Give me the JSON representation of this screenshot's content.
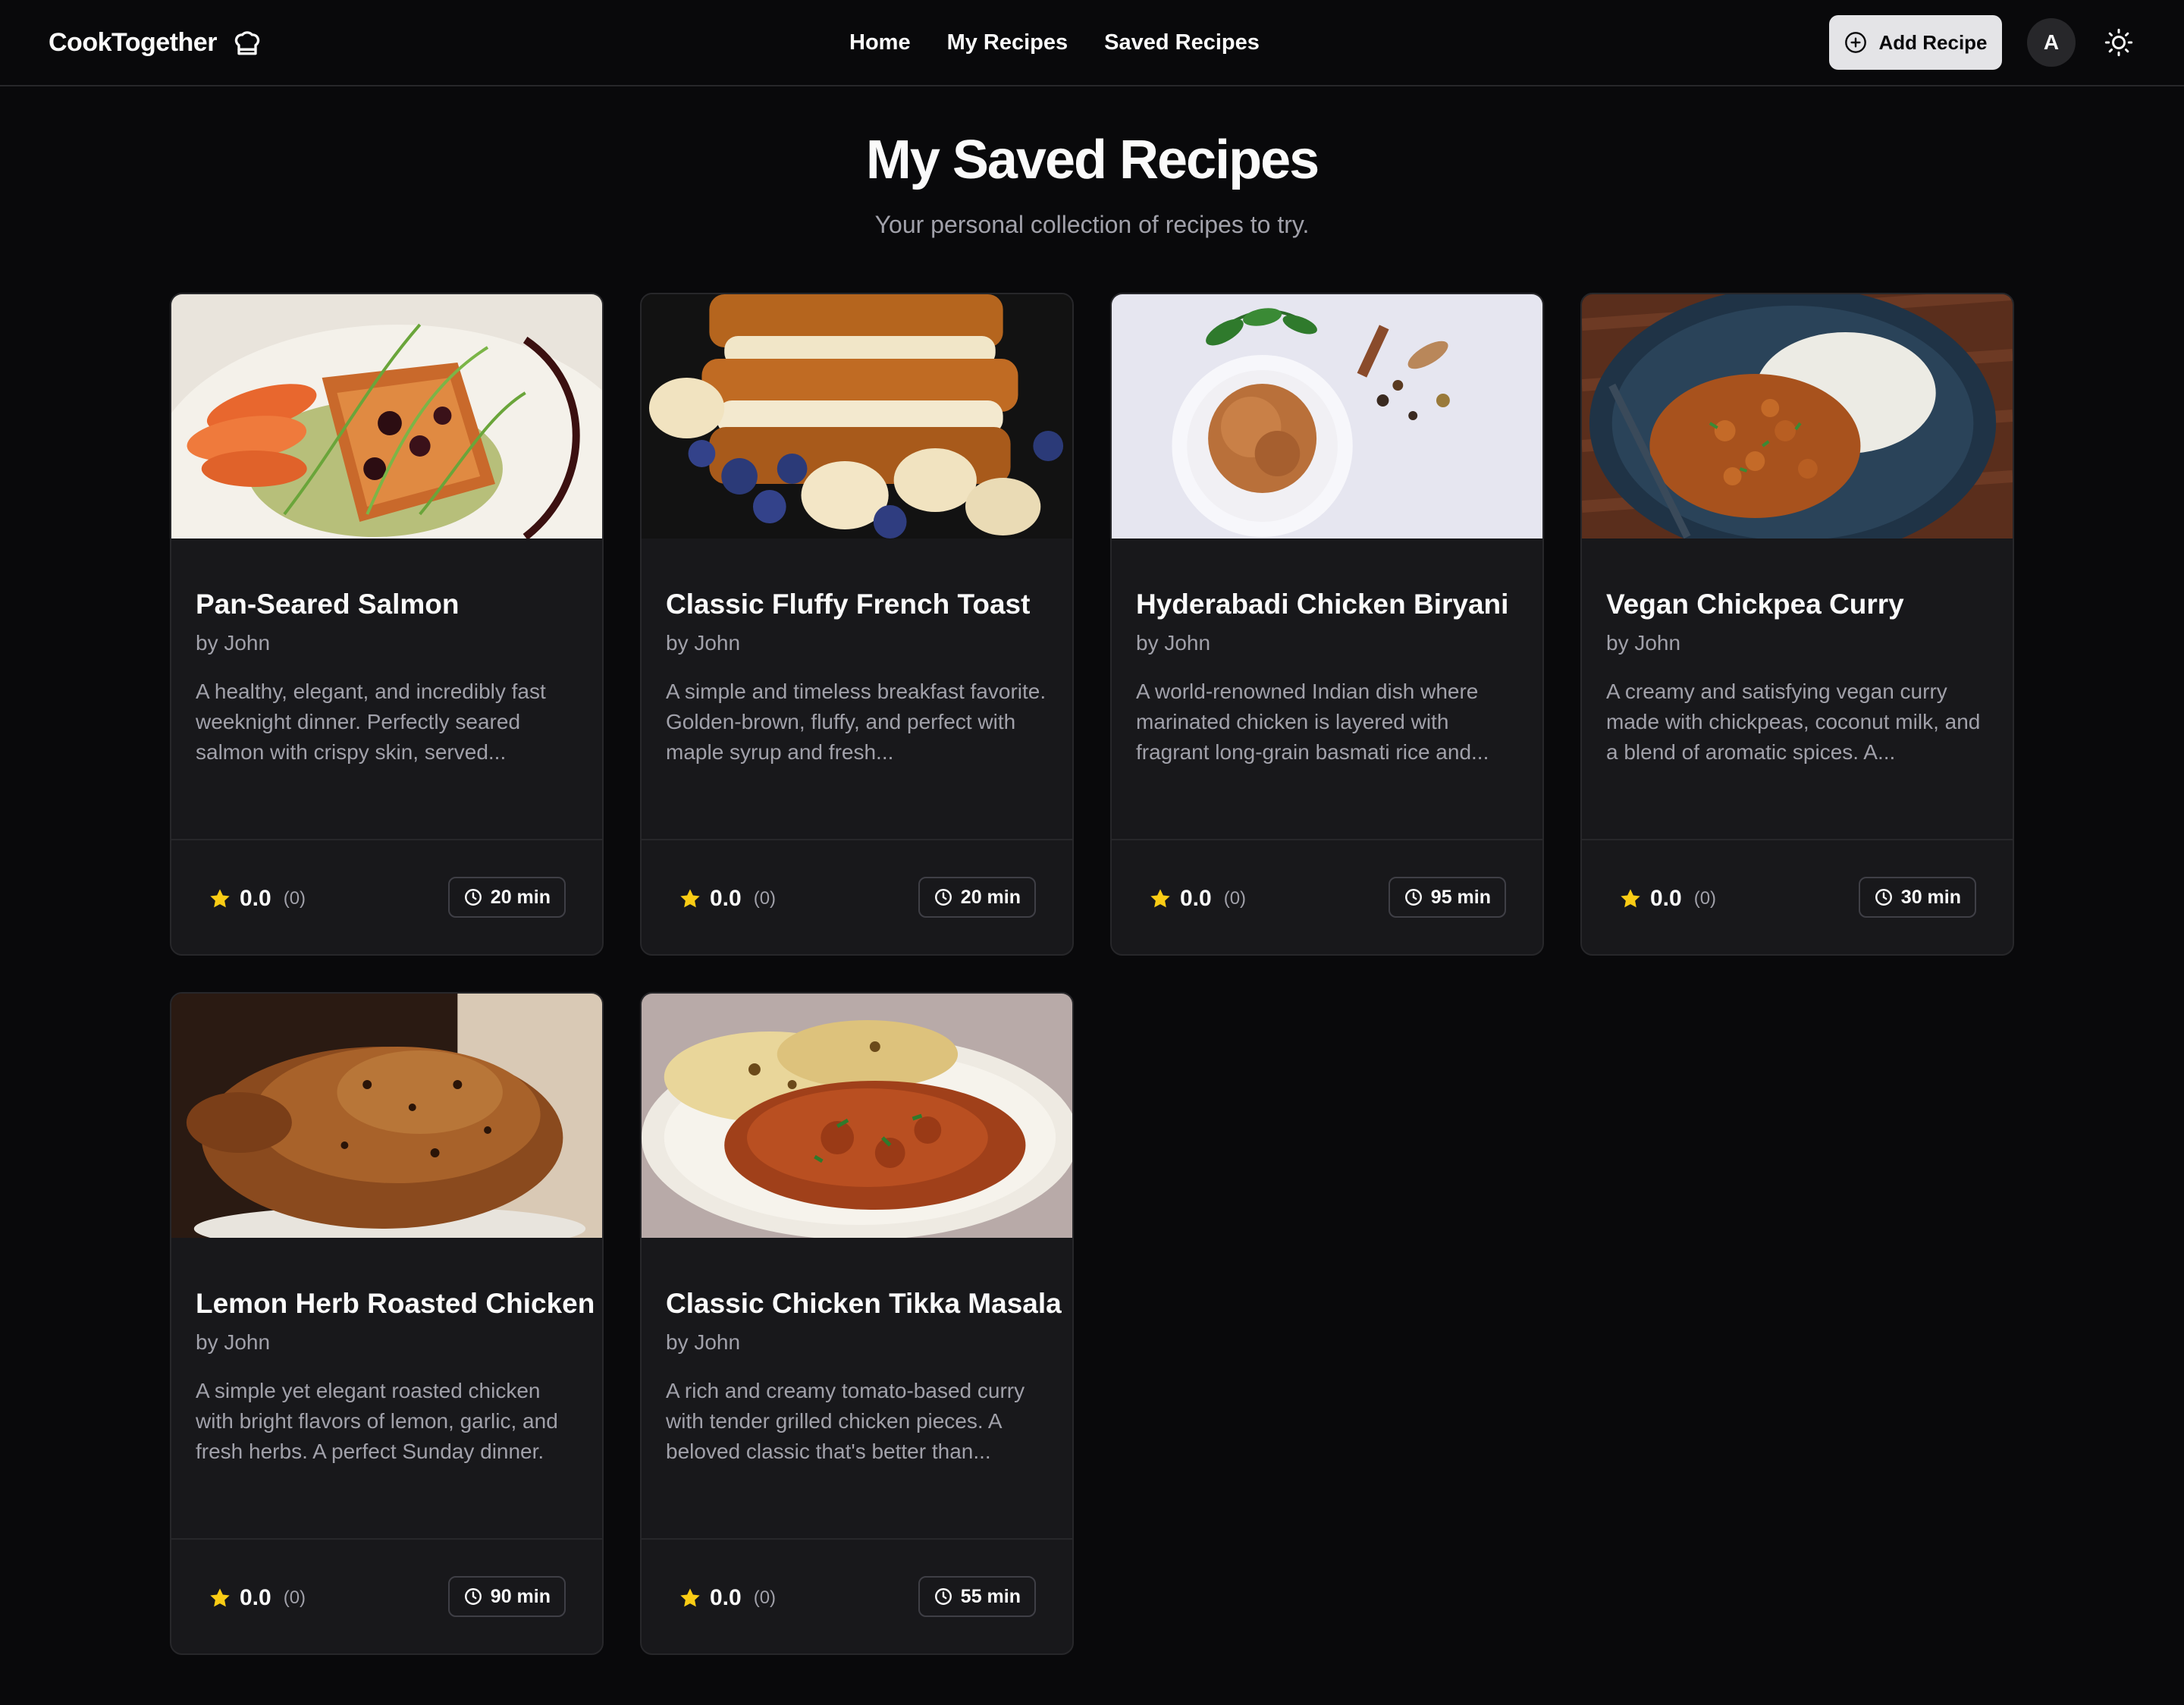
{
  "header": {
    "brand": "CookTogether",
    "brand_icon": "chef-hat-icon",
    "nav": [
      {
        "label": "Home"
      },
      {
        "label": "My Recipes"
      },
      {
        "label": "Saved Recipes"
      }
    ],
    "add_recipe_label": "Add Recipe",
    "add_icon": "plus-circle-icon",
    "avatar_initial": "A",
    "theme_icon": "sun-icon"
  },
  "page": {
    "title": "My Saved Recipes",
    "subtitle": "Your personal collection of recipes to try."
  },
  "colors": {
    "background": "#09090b",
    "card": "#18181b",
    "border": "#27272a",
    "muted_text": "#a1a1aa",
    "star": "#facc15",
    "button_bg": "#e4e4e7"
  },
  "recipes": [
    {
      "title": "Pan-Seared Salmon",
      "author": "by John",
      "description": "A healthy, elegant, and incredibly fast weeknight dinner. Perfectly seared salmon with crispy skin, served...",
      "rating": "0.0",
      "rating_count": "(0)",
      "time": "20 min",
      "image": "salmon-photo"
    },
    {
      "title": "Classic Fluffy French Toast",
      "author": "by John",
      "description": "A simple and timeless breakfast favorite. Golden-brown, fluffy, and perfect with maple syrup and fresh...",
      "rating": "0.0",
      "rating_count": "(0)",
      "time": "20 min",
      "image": "french-toast-photo"
    },
    {
      "title": "Hyderabadi Chicken Biryani",
      "author": "by John",
      "description": "A world-renowned Indian dish where marinated chicken is layered with fragrant long-grain basmati rice and...",
      "rating": "0.0",
      "rating_count": "(0)",
      "time": "95 min",
      "image": "biryani-photo"
    },
    {
      "title": "Vegan Chickpea Curry",
      "author": "by John",
      "description": "A creamy and satisfying vegan curry made with chickpeas, coconut milk, and a blend of aromatic spices. A...",
      "rating": "0.0",
      "rating_count": "(0)",
      "time": "30 min",
      "image": "chickpea-curry-photo"
    },
    {
      "title": "Lemon Herb Roasted Chicken",
      "author": "by John",
      "description": "A simple yet elegant roasted chicken with bright flavors of lemon, garlic, and fresh herbs. A perfect Sunday dinner.",
      "rating": "0.0",
      "rating_count": "(0)",
      "time": "90 min",
      "image": "roasted-chicken-photo"
    },
    {
      "title": "Classic Chicken Tikka Masala",
      "author": "by John",
      "description": "A rich and creamy tomato-based curry with tender grilled chicken pieces. A beloved classic that's better than...",
      "rating": "0.0",
      "rating_count": "(0)",
      "time": "55 min",
      "image": "tikka-masala-photo"
    }
  ]
}
